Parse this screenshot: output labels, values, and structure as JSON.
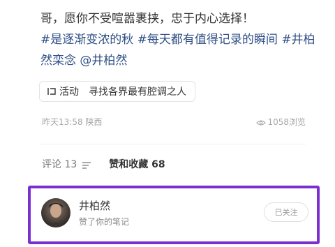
{
  "post": {
    "line1": "哥，愿你不受喧嚣裹挟，忠于内心选择！",
    "tag1": "#是逐渐变浓的秋",
    "tag2": "#每天都有值得记录的瞬间",
    "tag3": "#井柏",
    "tag3_cont": "然栾念",
    "mention": "@井柏然"
  },
  "activity": {
    "icon": "activity-tag-icon",
    "label": "活动",
    "title": "寻找各界最有腔调之人"
  },
  "meta": {
    "time": "昨天13:58",
    "location": "陕西",
    "views_icon": "eye-icon",
    "views": "1058浏览"
  },
  "tabs": {
    "comments_label": "评论 13",
    "sort_icon": "sort-icon",
    "likes_label": "赞和收藏 68"
  },
  "notification": {
    "user_name": "井柏然",
    "action": "赞了你的笔记",
    "follow_label": "已关注"
  },
  "colors": {
    "highlight_border": "#7a2fd0",
    "tag_text": "#2f4f86"
  }
}
